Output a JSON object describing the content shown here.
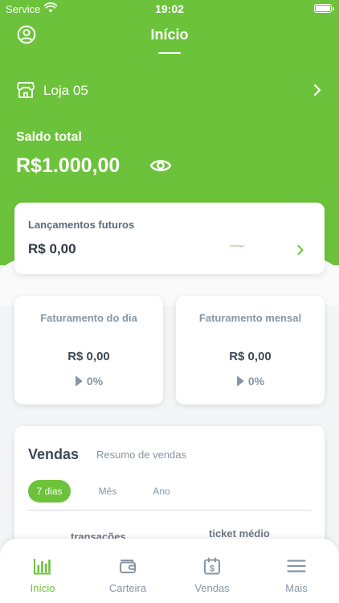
{
  "status_bar": {
    "carrier": "Service",
    "time": "19:02"
  },
  "header": {
    "title": "Início"
  },
  "store": {
    "name": "Loja 05"
  },
  "balance": {
    "label": "Saldo total",
    "value": "R$1.000,00"
  },
  "future": {
    "title": "Lançamentos futuros",
    "value": "R$ 0,00",
    "tag": "Ambergue"
  },
  "stats": [
    {
      "title": "Faturamento do dia",
      "value": "R$ 0,00",
      "percent": "0%"
    },
    {
      "title": "Faturamento mensal",
      "value": "R$ 0,00",
      "percent": "0%"
    }
  ],
  "sales": {
    "title": "Vendas",
    "subtitle": "Resumo de vendas",
    "filters": [
      "7 dias",
      "Mês",
      "Ano"
    ],
    "active_filter": "7 dias",
    "metrics": [
      "transações",
      "ticket médio"
    ]
  },
  "tabs": [
    {
      "label": "Início",
      "icon": "bar-chart-icon"
    },
    {
      "label": "Carteira",
      "icon": "wallet-icon"
    },
    {
      "label": "Vendas",
      "icon": "calendar-dollar-icon"
    },
    {
      "label": "Mais",
      "icon": "menu-icon"
    }
  ],
  "active_tab": "Início",
  "colors": {
    "brand": "#6cc33b",
    "text_muted": "#8796a3",
    "text_dark": "#3c4a57"
  }
}
